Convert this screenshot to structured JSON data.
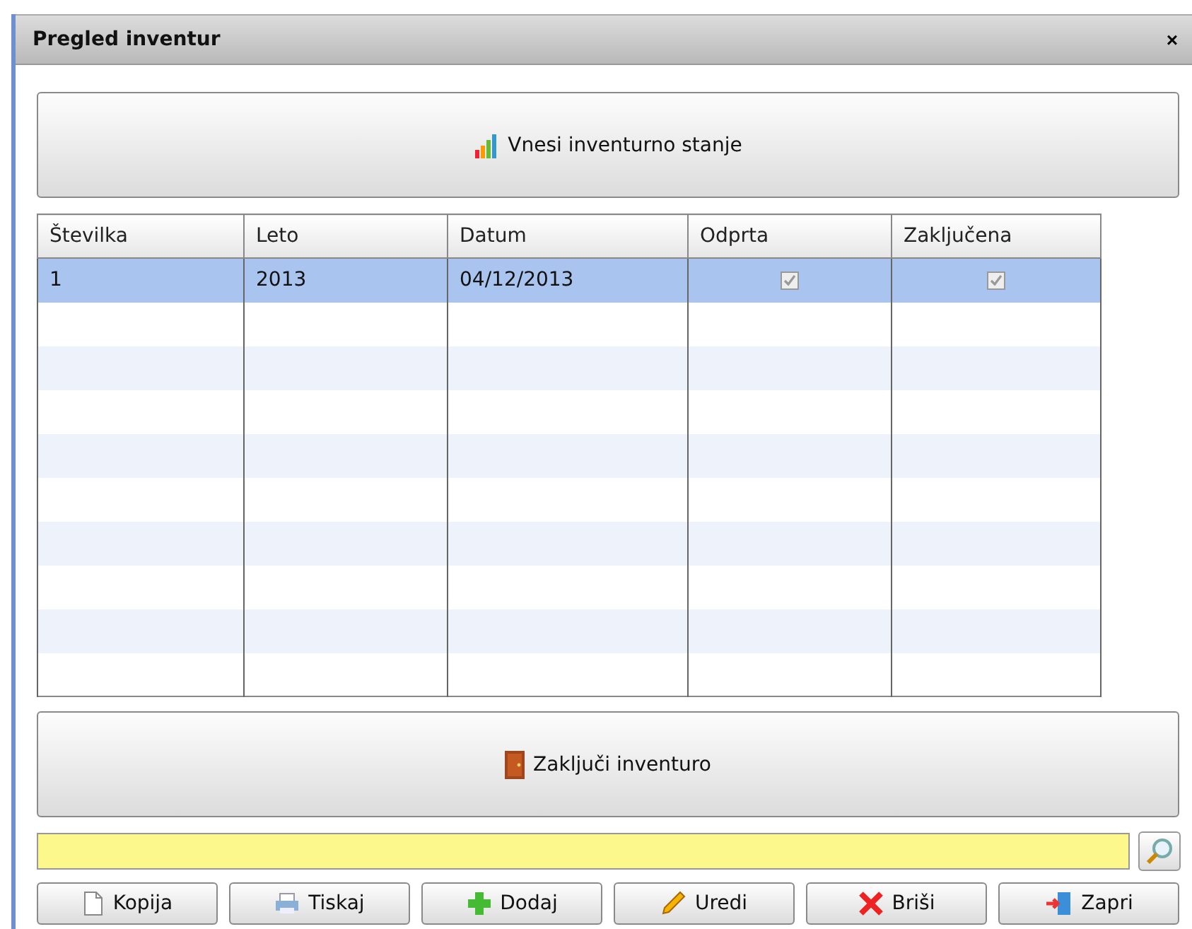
{
  "window": {
    "title": "Pregled inventur",
    "close": "×"
  },
  "top_button": {
    "label": "Vnesi inventurno stanje"
  },
  "table": {
    "columns": [
      "Številka",
      "Leto",
      "Datum",
      "Odprta",
      "Zaključena"
    ],
    "rows": [
      {
        "number": "1",
        "year": "2013",
        "date": "04/12/2013",
        "open": true,
        "closed": true,
        "selected": true
      }
    ]
  },
  "close_button": {
    "label": "Zaključi inventuro"
  },
  "buttons": [
    {
      "kind": "copy",
      "label": "Kopija"
    },
    {
      "kind": "print",
      "label": "Tiskaj"
    },
    {
      "kind": "add",
      "label": "Dodaj"
    },
    {
      "kind": "edit",
      "label": "Uredi"
    },
    {
      "kind": "delete",
      "label": "Briši"
    },
    {
      "kind": "exit",
      "label": "Zapri"
    }
  ]
}
